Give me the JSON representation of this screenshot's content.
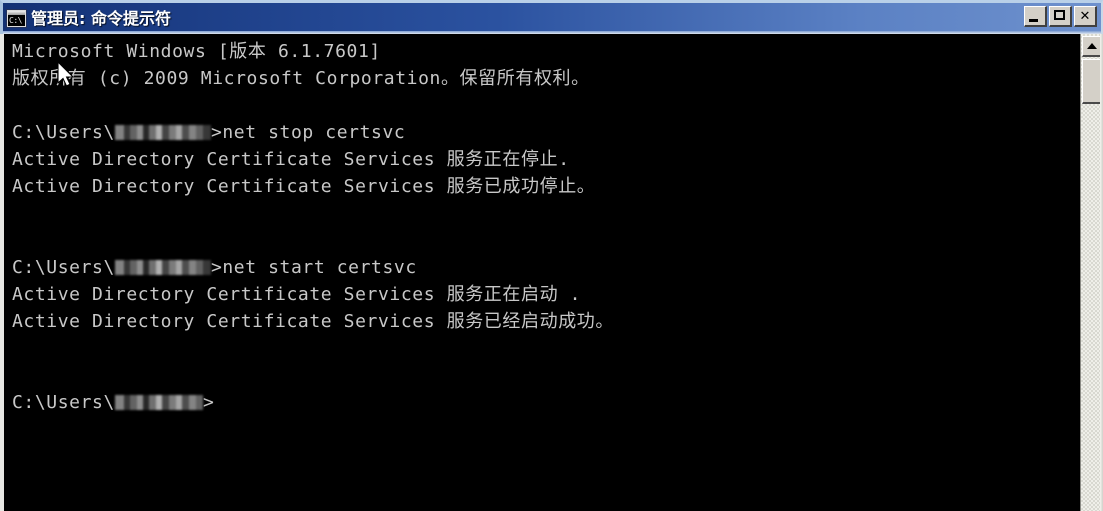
{
  "window": {
    "title": "管理员: 命令提示符",
    "icon": "cmd-icon",
    "icon_text": "C:\\",
    "colors": {
      "titlebar_dark": "#133174",
      "titlebar_light": "#6e91cd",
      "console_background": "#000000",
      "console_text": "#c8c8c8",
      "chrome": "#d4d0c8"
    },
    "controls": {
      "minimize": "_",
      "maximize": "□",
      "close": "✕"
    }
  },
  "scrollbar": {
    "up_arrow": "▲",
    "thumb_position": "top"
  },
  "console": {
    "lines": [
      {
        "text": "Microsoft Windows [版本 6.1.7601]",
        "type": "output"
      },
      {
        "text": "版权所有 (c) 2009 Microsoft Corporation。保留所有权利。",
        "type": "output"
      },
      {
        "text": "",
        "type": "blank"
      },
      {
        "prefix": "C:\\Users\\",
        "redacted": true,
        "suffix": ">net stop certsvc",
        "type": "prompt"
      },
      {
        "text": "Active Directory Certificate Services 服务正在停止.",
        "type": "output"
      },
      {
        "text": "Active Directory Certificate Services 服务已成功停止。",
        "type": "output"
      },
      {
        "text": "",
        "type": "blank"
      },
      {
        "text": "",
        "type": "blank"
      },
      {
        "prefix": "C:\\Users\\",
        "redacted": true,
        "suffix": ">net start certsvc",
        "type": "prompt"
      },
      {
        "text": "Active Directory Certificate Services 服务正在启动 .",
        "type": "output"
      },
      {
        "text": "Active Directory Certificate Services 服务已经启动成功。",
        "type": "output"
      },
      {
        "text": "",
        "type": "blank"
      },
      {
        "text": "",
        "type": "blank"
      },
      {
        "prefix": "C:\\Users\\",
        "redacted": true,
        "suffix": ">",
        "type": "prompt"
      }
    ]
  }
}
